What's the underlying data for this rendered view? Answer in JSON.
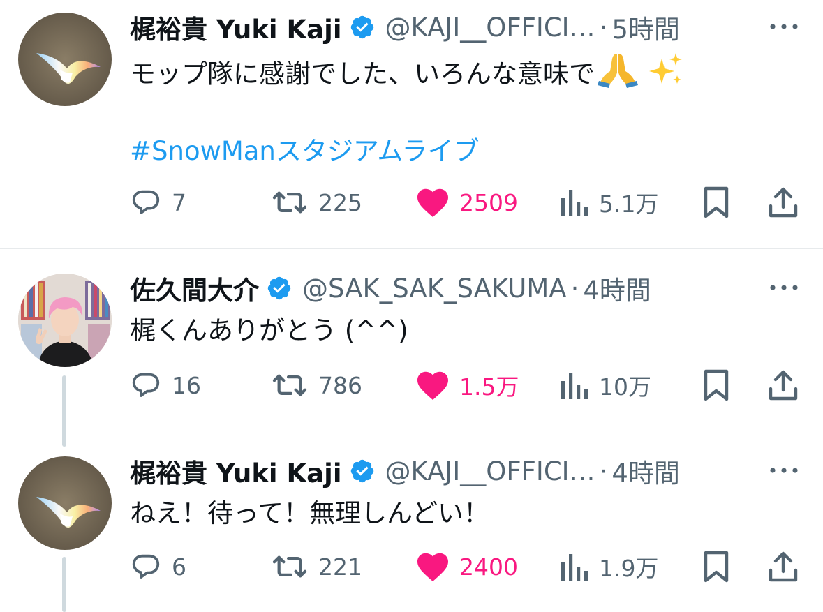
{
  "colors": {
    "text": "#0f1419",
    "secondary": "#536471",
    "hashtag": "#1d9bf0",
    "like": "#f91880",
    "verified": "#1d9bf0",
    "thread_line": "#cfd9de"
  },
  "tweets": [
    {
      "display_name": "梶裕貴 Yuki Kaji",
      "handle": "@KAJI__OFFICI…",
      "dot": "·",
      "time": "5時間",
      "text": "モップ隊に感謝でした、いろんな意味で",
      "emojis": [
        "folded-hands-icon",
        "sparkles-icon"
      ],
      "hashtag": "#SnowManスタジアムライブ",
      "replies": "7",
      "retweets": "225",
      "likes": "2509",
      "views": "5.1万"
    },
    {
      "display_name": "佐久間大介",
      "handle": "@SAK_SAK_SAKUMA",
      "dot": "·",
      "time": "4時間",
      "text": "梶くんありがとう (^^)",
      "replies": "16",
      "retweets": "786",
      "likes": "1.5万",
      "views": "10万"
    },
    {
      "display_name": "梶裕貴 Yuki Kaji",
      "handle": "@KAJI__OFFICI…",
      "dot": "·",
      "time": "4時間",
      "text": "ねえ！待って！無理しんどい！",
      "replies": "6",
      "retweets": "221",
      "likes": "2400",
      "views": "1.9万"
    }
  ]
}
